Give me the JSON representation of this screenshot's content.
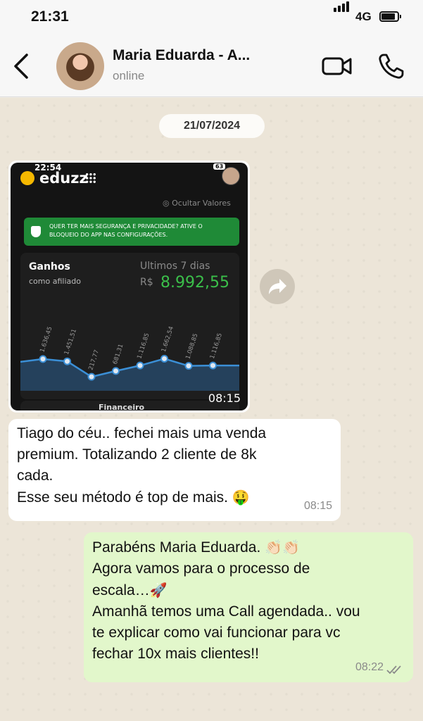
{
  "status_bar": {
    "time": "21:31",
    "network": "4G"
  },
  "header": {
    "contact_name": "Maria Eduarda - A...",
    "contact_status": "online"
  },
  "chat": {
    "date_separator": "21/07/2024",
    "image_message": {
      "time": "08:15",
      "screenshot": {
        "phone_time": "22:54",
        "battery": "63",
        "app_name": "eduzz",
        "hide_values": "Ocultar Valores",
        "banner_text": "QUER TER MAIS SEGURANÇA E PRIVACIDADE? ATIVE O BLOQUEIO DO APP NAS CONFIGURAÇÕES.",
        "card_title": "Ganhos",
        "card_subtitle": "como afiliado",
        "period": "Ultimos 7 dias",
        "currency": "R$",
        "total": "8.992,55",
        "next_section": "Financeiro",
        "accent_color": "#3bbf4a"
      }
    },
    "incoming": {
      "lines": [
        "Tiago do céu.. fechei mais uma venda",
        "premium. Totalizando 2 cliente de 8k",
        "cada.",
        "Esse seu método é top de mais."
      ],
      "emoji": "🤑",
      "time": "08:15"
    },
    "outgoing": {
      "lines": [
        "Parabéns Maria Eduarda.",
        "Agora vamos para o processo de",
        "escala…",
        "Amanhã temos uma Call agendada.. vou",
        "te explicar como vai funcionar para vc",
        "fechar 10x mais clientes!!"
      ],
      "emoji_line1": "👏🏻👏🏻",
      "emoji_line3": "🚀",
      "time": "08:22",
      "read_receipt": "double-check-icon"
    }
  },
  "chart_data": {
    "type": "line",
    "x": [
      1,
      2,
      3,
      4,
      5,
      6,
      7,
      8
    ],
    "labels": [
      "1.636,45",
      "1.451,51",
      "217,77",
      "681,31",
      "1.116,85",
      "1.662,54",
      "1.088,85",
      "1.116,85"
    ],
    "values": [
      1636.45,
      1451.51,
      217.77,
      681.31,
      1116.85,
      1662.54,
      1088.85,
      1116.85
    ],
    "color": "#3b8fd6",
    "ylim": [
      0,
      1800
    ],
    "grid": false
  }
}
